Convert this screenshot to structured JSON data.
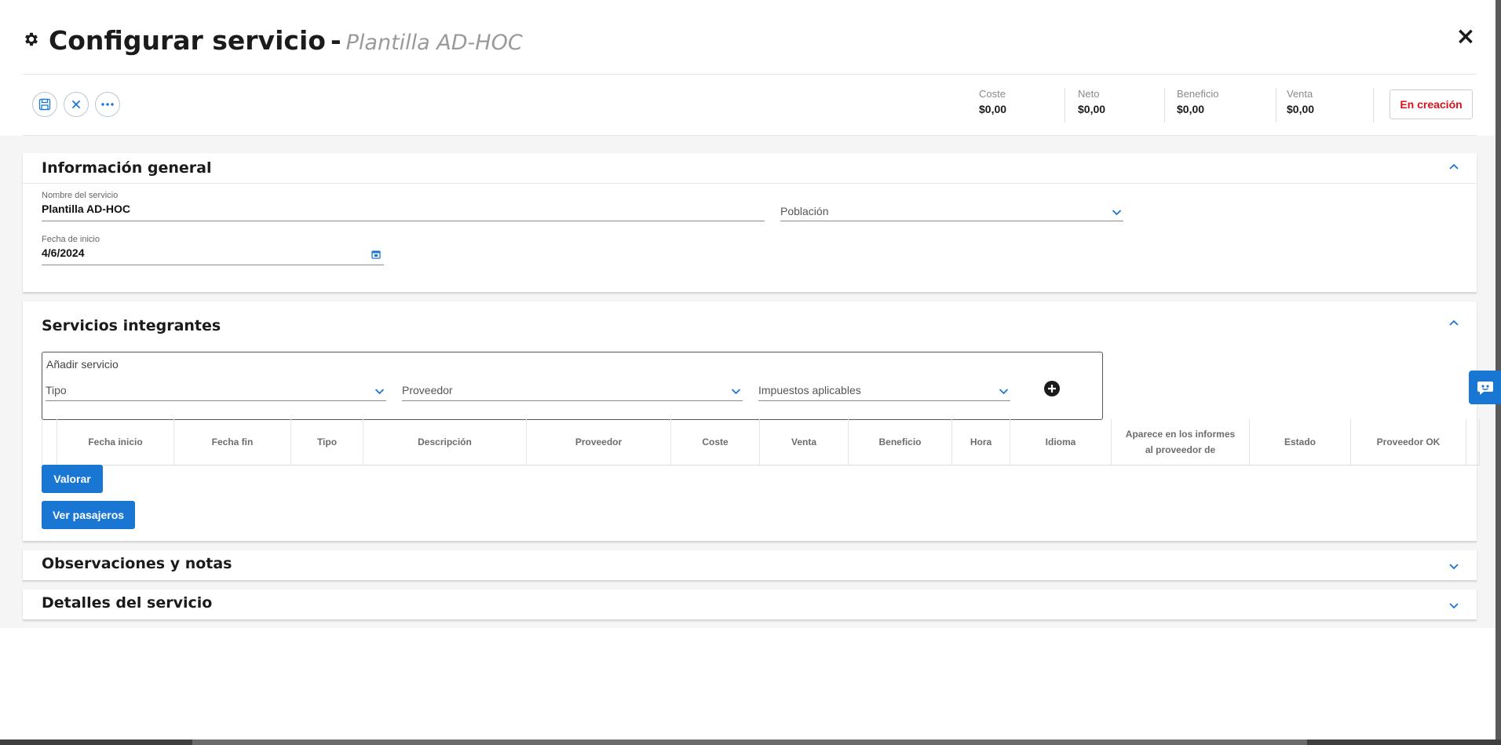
{
  "header": {
    "title": "Configurar servicio",
    "dash": "-",
    "subtitle": "Plantilla AD-HOC",
    "gear_icon": "gear-icon",
    "close_label": "×"
  },
  "toolbar": {
    "buttons": [
      "save-icon",
      "cancel-icon",
      "more-icon"
    ],
    "metrics": [
      {
        "label": "Coste",
        "value": "$0,00"
      },
      {
        "label": "Neto",
        "value": "$0,00"
      },
      {
        "label": "Beneficio",
        "value": "$0,00"
      },
      {
        "label": "Venta",
        "value": "$0,00"
      }
    ],
    "status": "En creación",
    "status_color": "#d9111c"
  },
  "general": {
    "title": "Información general",
    "nombre_label": "Nombre del servicio",
    "nombre_value": "Plantilla AD-HOC",
    "poblacion_placeholder": "Población",
    "fecha_label": "Fecha de inicio",
    "fecha_value": "4/6/2024"
  },
  "integrantes": {
    "title": "Servicios integrantes",
    "add_title": "Añadir servicio",
    "tipo_placeholder": "Tipo",
    "proveedor_placeholder": "Proveedor",
    "impuestos_placeholder": "Impuestos aplicables",
    "columns": [
      "Fecha inicio",
      "Fecha fin",
      "Tipo",
      "Descripción",
      "Proveedor",
      "Coste",
      "Venta",
      "Beneficio",
      "Hora",
      "Idioma",
      "Aparece en los informes al proveedor de",
      "Estado",
      "Proveedor OK"
    ],
    "valorar_label": "Valorar",
    "pasajeros_label": "Ver pasajeros"
  },
  "observaciones": {
    "title": "Observaciones y notas"
  },
  "detalles": {
    "title": "Detalles del servicio"
  },
  "colors": {
    "accent": "#1976d2"
  }
}
